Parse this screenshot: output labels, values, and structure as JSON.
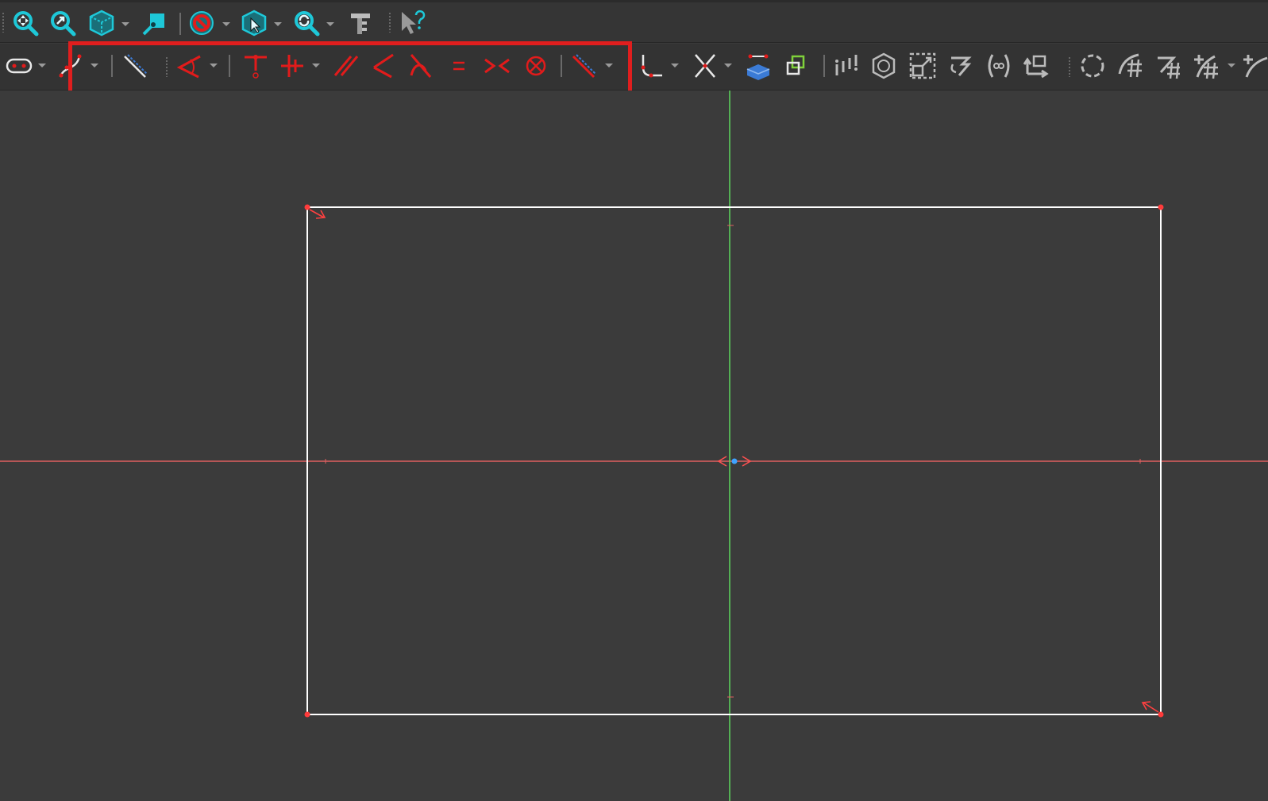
{
  "colors": {
    "background": "#3b3b3b",
    "toolbar": "#353535",
    "highlight": "#e01e1e",
    "teal_icon": "#1ec8d8",
    "constraint_red": "#e21b1b",
    "h_axis": "#e06060",
    "v_axis": "#5cd65c",
    "geometry": "#ffffff"
  },
  "toolbar_top": {
    "items": [
      {
        "name": "fit-all-icon"
      },
      {
        "name": "fit-selection-icon"
      },
      {
        "name": "standard-views-icon"
      },
      {
        "name": "sketch-view-section-icon"
      },
      {
        "name": "draw-style-icon"
      },
      {
        "name": "bounding-box-icon"
      },
      {
        "name": "refresh-zoom-icon"
      },
      {
        "name": "measure-icon"
      },
      {
        "name": "whats-this-icon"
      }
    ]
  },
  "toolbar_sketch": {
    "geometry_tools": [
      "slot-icon",
      "bspline-icon",
      "construction-mode-icon"
    ],
    "constraint_tools": [
      "angle-constraint-icon",
      "coincident-constraint-icon",
      "point-on-object-constraint-icon",
      "parallel-constraint-icon",
      "perpendicular-constraint-icon",
      "tangent-constraint-icon",
      "equal-constraint-icon",
      "symmetric-constraint-icon",
      "block-constraint-icon",
      "toggle-driving-constraint-icon"
    ],
    "edit_tools": [
      "fillet-icon",
      "trim-icon",
      "external-geometry-icon",
      "carbon-copy-icon",
      "select-constraints-icon",
      "select-origin-icon",
      "select-axes-icon",
      "symmetry-icon",
      "clone-icon",
      "rectangular-array-icon",
      "move-icon",
      "close-shape-icon",
      "connect-edges-icon",
      "select-conflicting-icon",
      "select-redundant-icon",
      "bspline-tool-icon"
    ]
  },
  "sketch": {
    "rectangle": {
      "width_units": 1055,
      "height_units": 628
    },
    "constraints_shown": [
      "horizontal-symmetry",
      "corner-arrows"
    ]
  }
}
